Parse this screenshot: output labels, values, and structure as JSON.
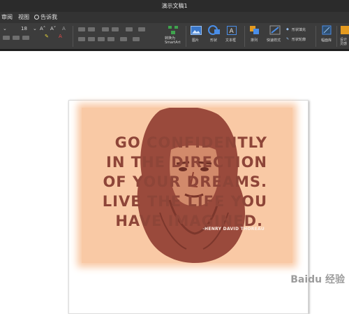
{
  "window": {
    "title": "演示文稿1"
  },
  "menu": {
    "items": [
      "审阅",
      "视图"
    ],
    "tell_me": "告诉我"
  },
  "ribbon": {
    "font_size": "18",
    "smartart_label": "转换为 SmartArt",
    "picture_label": "图片",
    "shapes_label": "形状",
    "textbox_label": "文本框",
    "arrange_label": "排列",
    "quick_styles_label": "快速样式",
    "shape_fill_label": "形状填充",
    "shape_outline_label": "形状轮廓",
    "design_ideas_label": "幅面库",
    "partial_label": "设计 灵感"
  },
  "slide": {
    "quote_lines": [
      "GO CONFIDENTLY",
      "IN THE DIRECTION",
      "OF YOUR DREAMS.",
      "LIVE THE LIFE YOU",
      "HAVE IMAGINED."
    ],
    "author": "-HENRY DAVID THOREAU",
    "colors": {
      "background": "#f9c9a5",
      "text": "#8e4538",
      "portrait": "#9a4a3c"
    }
  },
  "watermark": "Baidu 经验"
}
